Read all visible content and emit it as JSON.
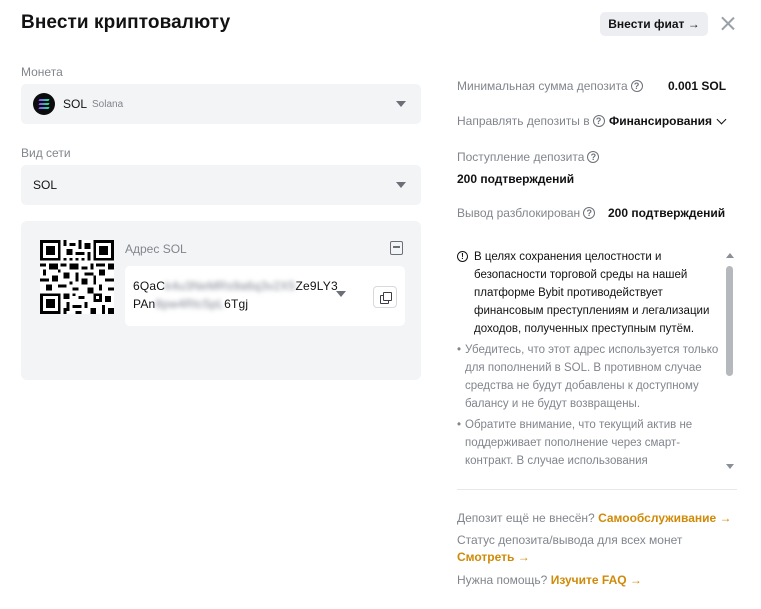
{
  "header": {
    "title": "Внести криптовалюту",
    "fiat_button": "Внести фиат →"
  },
  "coin": {
    "label": "Монета",
    "symbol": "SOL",
    "name": "Solana"
  },
  "network": {
    "label": "Вид сети",
    "value": "SOL"
  },
  "address": {
    "label": "Адрес SOL",
    "line1_start": "6QaC",
    "line1_hidden": "k4u3NeMRs9a6q3v2X5",
    "line1_end": "Ze9LY3",
    "line2_start": "PAn",
    "line2_hidden": "8pw4Rtc5pL",
    "line2_end": "6Tgj"
  },
  "info": {
    "min_deposit_label": "Минимальная сумма депозита",
    "min_deposit_value": "0.001 SOL",
    "direct_label": "Направлять депозиты в",
    "direct_value": "Финансирования",
    "arrival_label": "Поступление депозита",
    "arrival_value": "200 подтверждений",
    "unlock_label": "Вывод разблокирован",
    "unlock_value": "200 подтверждений"
  },
  "notice": {
    "main": "В целях сохранения целостности и безопасности торговой среды на нашей платформе Bybit противодействует финансовым преступлениям и легализации доходов, полученных преступным путём.",
    "items": [
      "Убедитесь, что этот адрес используется только для пополнений в SOL. В противном случае средства не будут добавлены к доступному балансу и не будут возвращены.",
      "Обратите внимание, что текущий актив не поддерживает пополнение через смарт-контракт. В случае использования"
    ]
  },
  "footer": {
    "not_arrived": "Депозит ещё не внесён?",
    "self_service": "Самообслуживание →",
    "status_text": "Статус депозита/вывода для всех монет",
    "view_link": "Смотреть →",
    "help_text": "Нужна помощь?",
    "faq_link": "Изучите FAQ →"
  },
  "colors": {
    "accent": "#d08a08",
    "panel_bg": "#f3f4f6",
    "muted_text": "#81858c"
  }
}
